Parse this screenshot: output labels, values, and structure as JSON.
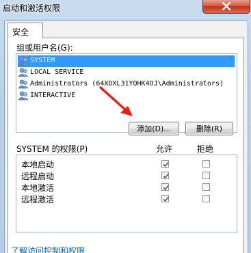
{
  "window": {
    "title": "启动和激活权限"
  },
  "tabs": [
    {
      "label": "安全"
    }
  ],
  "group_label": "组或用户名(G):",
  "users": [
    {
      "name": "SYSTEM",
      "selected": true,
      "icon": "users-group-icon"
    },
    {
      "name": "LOCAL SERVICE",
      "selected": false,
      "icon": "users-group-icon"
    },
    {
      "name": "Administrators (64XDXL31YOHK4OJ\\Administrators)",
      "selected": false,
      "icon": "users-group-icon"
    },
    {
      "name": "INTERACTIVE",
      "selected": false,
      "icon": "users-group-icon"
    }
  ],
  "buttons": {
    "add": "添加(D)...",
    "remove": "删除(R)"
  },
  "permissions": {
    "header_label": "SYSTEM 的权限(P)",
    "allow_header": "允许",
    "deny_header": "拒绝",
    "rows": [
      {
        "name": "本地启动",
        "allow": true,
        "deny": false
      },
      {
        "name": "远程启动",
        "allow": true,
        "deny": false
      },
      {
        "name": "本地激活",
        "allow": true,
        "deny": false
      },
      {
        "name": "远程激活",
        "allow": true,
        "deny": false
      }
    ]
  },
  "link_text": "了解访问控制和权限",
  "colors": {
    "selection": "#3399ff",
    "annotation_arrow": "#e8201a",
    "link": "#0066cc"
  }
}
